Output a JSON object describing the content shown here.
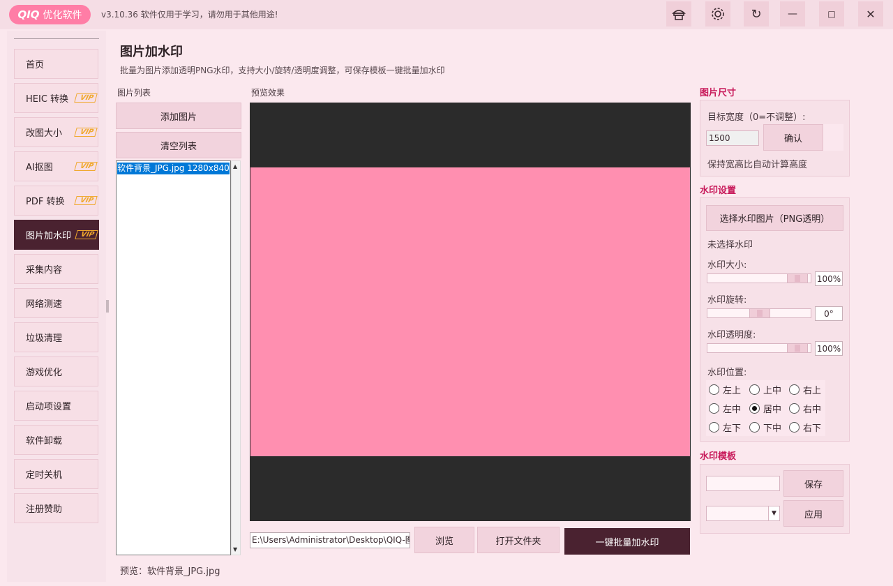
{
  "app": {
    "logo_mark": "QIQ",
    "logo_text": "优化软件",
    "version_text": "v3.10.36 软件仅用于学习，请勿用于其他用途!"
  },
  "titlebar_icons": [
    "hat-icon",
    "gear-icon",
    "refresh-icon",
    "minimize-icon",
    "maximize-icon",
    "close-icon"
  ],
  "titlebar_glyphs": {
    "refresh": "↻",
    "minimize": "—",
    "maximize": "□",
    "close": "✕"
  },
  "sidebar": {
    "items": [
      {
        "label": "首页",
        "vip": false
      },
      {
        "label": "HEIC 转换",
        "vip": true
      },
      {
        "label": "改图大小",
        "vip": true
      },
      {
        "label": "AI抠图",
        "vip": true
      },
      {
        "label": "PDF 转换",
        "vip": true
      },
      {
        "label": "图片加水印",
        "vip": true,
        "active": true
      },
      {
        "label": "采集内容",
        "vip": false
      },
      {
        "label": "网络测速",
        "vip": false
      },
      {
        "label": "垃圾清理",
        "vip": false
      },
      {
        "label": "游戏优化",
        "vip": false
      },
      {
        "label": "启动项设置",
        "vip": false
      },
      {
        "label": "软件卸载",
        "vip": false
      },
      {
        "label": "定时关机",
        "vip": false
      },
      {
        "label": "注册赞助",
        "vip": false
      }
    ],
    "vip_badge": "VIP"
  },
  "header": {
    "title": "图片加水印",
    "subtitle": "批量为图片添加透明PNG水印，支持大小/旋转/透明度调整，可保存模板一键批量加水印"
  },
  "image_list": {
    "label": "图片列表",
    "add_button": "添加图片",
    "clear_button": "清空列表",
    "items": [
      "软件背景_JPG.jpg  1280x840"
    ]
  },
  "preview": {
    "label": "预览效果",
    "background_color": "#2b2b2b",
    "image_color": "#ff8fb0",
    "status_text": "预览：软件背景_JPG.jpg"
  },
  "output": {
    "path_value": "E:\\Users\\Administrator\\Desktop\\QIQ-图",
    "browse_button": "浏览",
    "open_folder_button": "打开文件夹",
    "run_button": "一键批量加水印"
  },
  "size_panel": {
    "title": "图片尺寸",
    "width_label": "目标宽度（0=不调整）:",
    "width_value": "1500",
    "confirm_button": "确认",
    "note": "保持宽高比自动计算高度"
  },
  "watermark_panel": {
    "title": "水印设置",
    "select_button": "选择水印图片（PNG透明）",
    "status": "未选择水印",
    "size_label": "水印大小:",
    "size_value": "100%",
    "size_level": 1.0,
    "rotate_label": "水印旋转:",
    "rotate_value": "0°",
    "rotate_level": 0.5,
    "opacity_label": "水印透明度:",
    "opacity_value": "100%",
    "opacity_level": 1.0,
    "position_label": "水印位置:",
    "positions": [
      [
        "左上",
        "上中",
        "右上"
      ],
      [
        "左中",
        "居中",
        "右中"
      ],
      [
        "左下",
        "下中",
        "右下"
      ]
    ],
    "selected_position": "居中"
  },
  "template_panel": {
    "title": "水印模板",
    "name_value": "",
    "save_button": "保存",
    "select_value": "",
    "apply_button": "应用"
  },
  "colors": {
    "accent": "#c8195a",
    "dark": "#4a2230",
    "logo_bg": "#ff7da6",
    "vip": "#f0a82c"
  }
}
